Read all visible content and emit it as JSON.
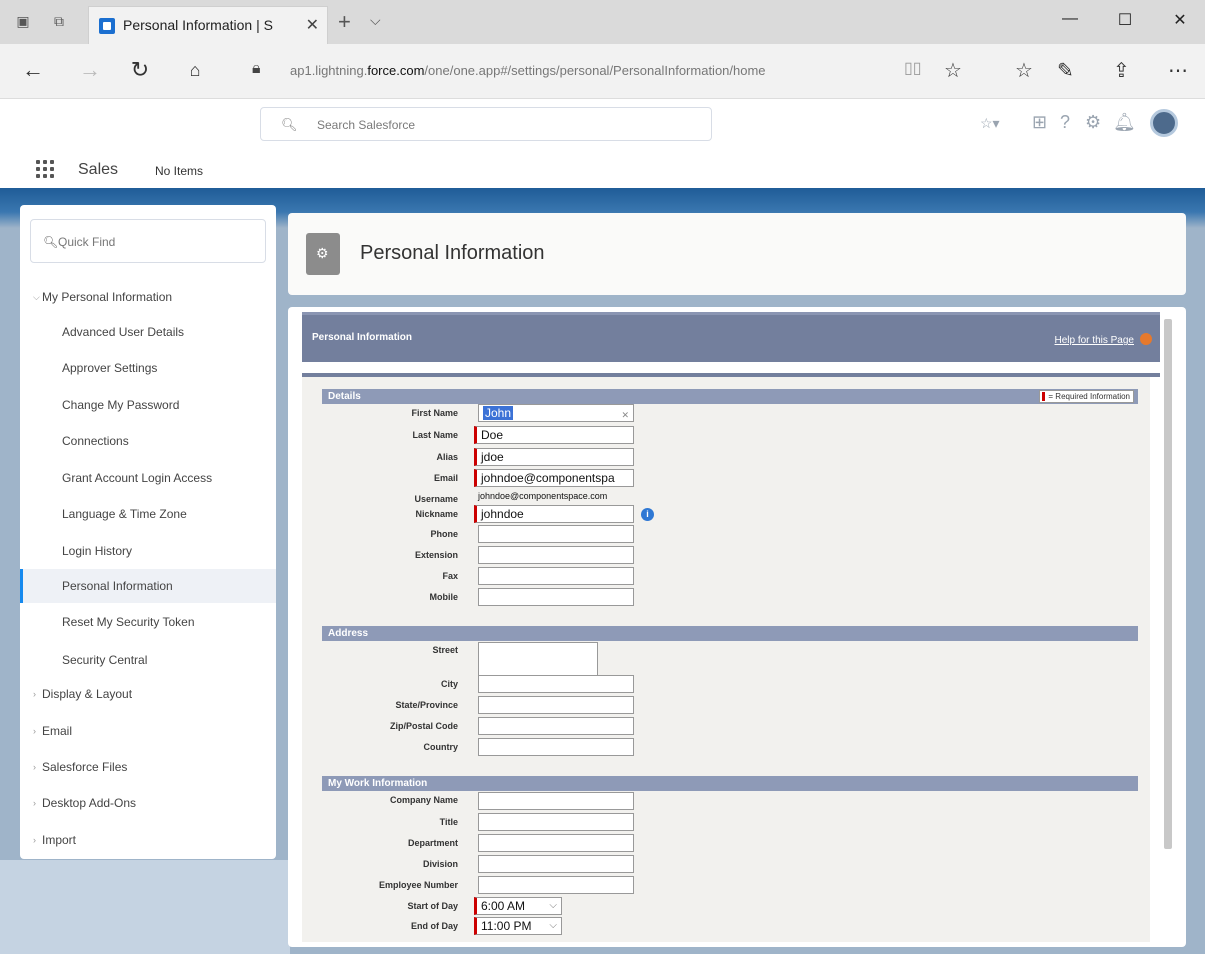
{
  "browser": {
    "tab_title": "Personal Information | S",
    "url_prefix": "ap1.lightning.",
    "url_domain": "force.com",
    "url_path": "/one/one.app#/settings/personal/PersonalInformation/home"
  },
  "header": {
    "search_placeholder": "Search Salesforce",
    "app_name": "Sales",
    "nav_items": "No Items"
  },
  "sidebar": {
    "quick_find": "Quick Find",
    "items": [
      {
        "label": "My Personal Information",
        "expanded": true
      },
      {
        "label": "Advanced User Details"
      },
      {
        "label": "Approver Settings"
      },
      {
        "label": "Change My Password"
      },
      {
        "label": "Connections"
      },
      {
        "label": "Grant Account Login Access"
      },
      {
        "label": "Language & Time Zone"
      },
      {
        "label": "Login History"
      },
      {
        "label": "Personal Information",
        "active": true
      },
      {
        "label": "Reset My Security Token"
      },
      {
        "label": "Security Central"
      },
      {
        "label": "Display & Layout"
      },
      {
        "label": "Email"
      },
      {
        "label": "Salesforce Files"
      },
      {
        "label": "Desktop Add-Ons"
      },
      {
        "label": "Import"
      }
    ]
  },
  "page": {
    "title": "Personal Information",
    "band_title": "Personal Information",
    "help_link": "Help for this Page",
    "required_info": "= Required Information"
  },
  "sections": {
    "details": "Details",
    "address": "Address",
    "work": "My Work Information"
  },
  "details": {
    "first_name_label": "First Name",
    "first_name": "John",
    "last_name_label": "Last Name",
    "last_name": "Doe",
    "alias_label": "Alias",
    "alias": "jdoe",
    "email_label": "Email",
    "email": "johndoe@componentspa",
    "username_label": "Username",
    "username": "johndoe@componentspace.com",
    "nickname_label": "Nickname",
    "nickname": "johndoe",
    "phone_label": "Phone",
    "extension_label": "Extension",
    "fax_label": "Fax",
    "mobile_label": "Mobile"
  },
  "address": {
    "street_label": "Street",
    "city_label": "City",
    "state_label": "State/Province",
    "zip_label": "Zip/Postal Code",
    "country_label": "Country"
  },
  "work": {
    "company_label": "Company Name",
    "title_label": "Title",
    "department_label": "Department",
    "division_label": "Division",
    "employee_number_label": "Employee Number",
    "start_of_day_label": "Start of Day",
    "start_of_day": "6:00 AM",
    "end_of_day_label": "End of Day",
    "end_of_day": "11:00 PM"
  },
  "colors": {
    "band": "#737f9d",
    "section": "#8e9ab7",
    "required": "#cc0000",
    "accent": "#1589ee"
  }
}
